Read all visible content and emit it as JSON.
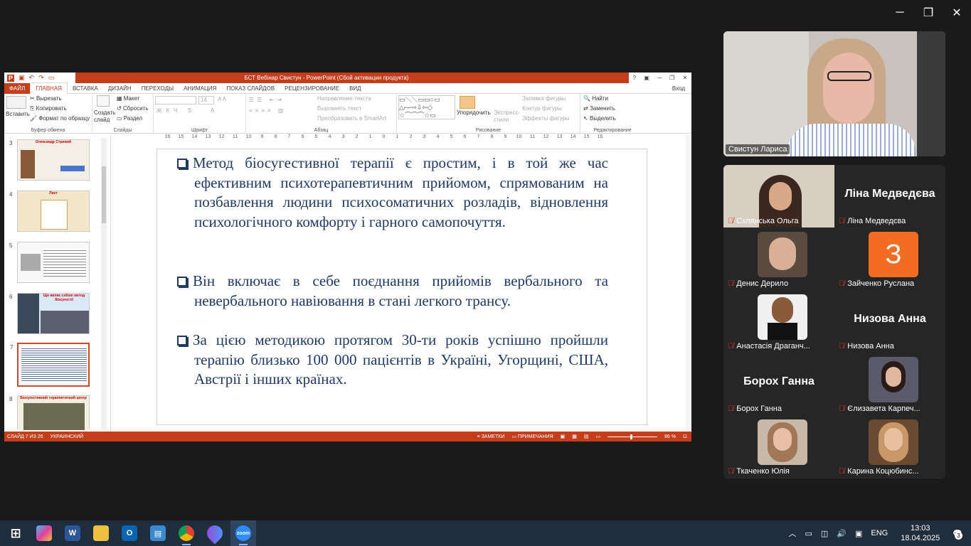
{
  "window_controls": {
    "minimize": "─",
    "restore": "❐",
    "close": "✕"
  },
  "ppt": {
    "title": "БСТ Вебінар Свистун - PowerPoint (Сбой активации продукта)",
    "title_controls": [
      "?",
      "▣",
      "─",
      "❐",
      "✕"
    ],
    "tabs": [
      "ФАЙЛ",
      "ГЛАВНАЯ",
      "ВСТАВКА",
      "ДИЗАЙН",
      "ПЕРЕХОДЫ",
      "АНИМАЦИЯ",
      "ПОКАЗ СЛАЙДОВ",
      "РЕЦЕНЗИРОВАНИЕ",
      "ВИД"
    ],
    "login": "Вход",
    "ribbon": {
      "paste": "Вставить",
      "cut": "Вырезать",
      "copy": "Копировать",
      "format_painter": "Формат по образцу",
      "clipboard_label": "Буфер обмена",
      "new_slide": "Создать слайд",
      "layout": "Макет",
      "reset": "Сбросить",
      "section": "Раздел",
      "slides_label": "Слайды",
      "font_size": "14",
      "font_label": "Шрифт",
      "text_direction": "Направление текста",
      "align_text": "Выровнять текст",
      "smartart": "Преобразовать в SmartArt",
      "paragraph_label": "Абзац",
      "arrange": "Упорядочить",
      "quick_styles": "Экспресс-стили",
      "drawing_label": "Рисование",
      "shape_fill": "Заливка фигуры",
      "shape_outline": "Контур фигуры",
      "shape_effects": "Эффекты фигуры",
      "find": "Найти",
      "replace": "Заменить",
      "select": "Выделить",
      "editing_label": "Редактирование"
    },
    "ruler_ticks": [
      "16",
      "15",
      "14",
      "13",
      "12",
      "11",
      "10",
      "9",
      "8",
      "7",
      "6",
      "5",
      "4",
      "3",
      "2",
      "1",
      "0",
      "1",
      "2",
      "3",
      "4",
      "5",
      "6",
      "7",
      "8",
      "9",
      "10",
      "11",
      "12",
      "13",
      "14",
      "15",
      "16"
    ],
    "thumbnails": [
      {
        "num": "3",
        "title": "Олександр Стрижий"
      },
      {
        "num": "4",
        "title": "Лист"
      },
      {
        "num": "5",
        "title": ""
      },
      {
        "num": "6",
        "title": "Що являє собою метод біосугестії"
      },
      {
        "num": "7",
        "title": ""
      },
      {
        "num": "8",
        "title": "Біосугестивний терапевтичний центр"
      }
    ],
    "slide_bullets": [
      "Метод біосугестивної терапії є простим, і в той же час ефективним психотерапевтичним прийомом, спрямованим на позбавлення людини психосоматичних розладів, відновлення психологічного комфорту і гарного самопочуття.",
      "Він включає в себе поєднання прийомів вербального та невербального навіювання в стані легкого трансу.",
      "За цією методикою протягом 30-ти років успішно пройшли терапію близько 100 000 пацієнтів в Україні, Угорщині, США, Австрії і інших країнах."
    ],
    "status": {
      "slide": "СЛАЙД 7 ИЗ 26",
      "language": "УКРАИНСКИЙ",
      "notes": "ЗАМЕТКИ",
      "comments": "ПРИМЕЧАНИЯ",
      "zoom": "86 %"
    }
  },
  "zoom": {
    "active_speaker": "Свистун Лариса",
    "participants": [
      {
        "name": "Склянська Ольга",
        "type": "video"
      },
      {
        "name": "Ліна Медведєва",
        "type": "text",
        "display": "Ліна Медведєва"
      },
      {
        "name": "Денис Дерило",
        "type": "video"
      },
      {
        "name": "Зайченко Руслана",
        "type": "initial",
        "display": "З"
      },
      {
        "name": "Анастасія Драганч...",
        "type": "video"
      },
      {
        "name": "Низова Анна",
        "type": "text",
        "display": "Низова Анна"
      },
      {
        "name": "Борох Ганна",
        "type": "text",
        "display": "Борох Ганна"
      },
      {
        "name": "Єлизавета Карпеч...",
        "type": "video"
      },
      {
        "name": "Ткаченко Юлія",
        "type": "video"
      },
      {
        "name": "Карина Коцюбинс...",
        "type": "video"
      }
    ]
  },
  "taskbar": {
    "apps": [
      "windows-start",
      "copilot",
      "word",
      "file-explorer",
      "outlook",
      "control-panel",
      "chrome",
      "paint",
      "zoom"
    ],
    "lang": "ENG",
    "time": "13:03",
    "date": "18.04.2025",
    "notifications": "3"
  },
  "colors": {
    "ppt_accent": "#c43e1c",
    "slide_text": "#1f3864",
    "taskbar": "#1f2d3d",
    "zoom_orange": "#f26d21"
  }
}
